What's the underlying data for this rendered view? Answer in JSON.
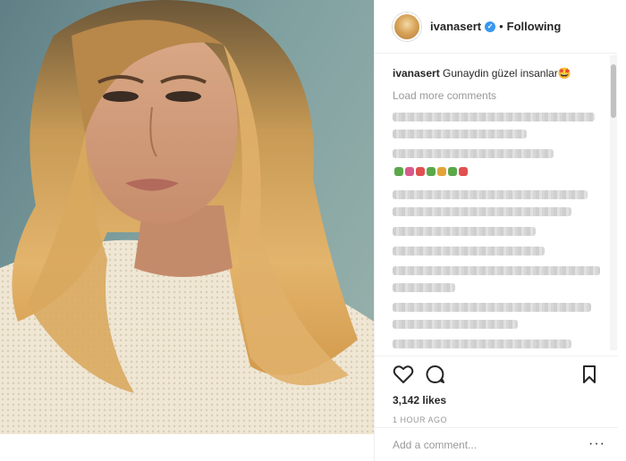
{
  "post": {
    "username": "ivanasert",
    "follow_status": "Following",
    "caption_user": "ivanasert",
    "caption_text": "Gunaydin güzel insanlar🤩",
    "load_more_label": "Load more comments",
    "likes": "3,142 likes",
    "time_ago": "1 HOUR AGO",
    "comment_placeholder": "Add a comment...",
    "more_options": "···"
  },
  "colors": {
    "verified": "#3897f0",
    "muted_text": "#999999",
    "border": "#efefef"
  },
  "icons": {
    "verified": "check-badge-icon",
    "like": "heart-icon",
    "comment": "speech-bubble-icon",
    "save": "bookmark-icon"
  }
}
